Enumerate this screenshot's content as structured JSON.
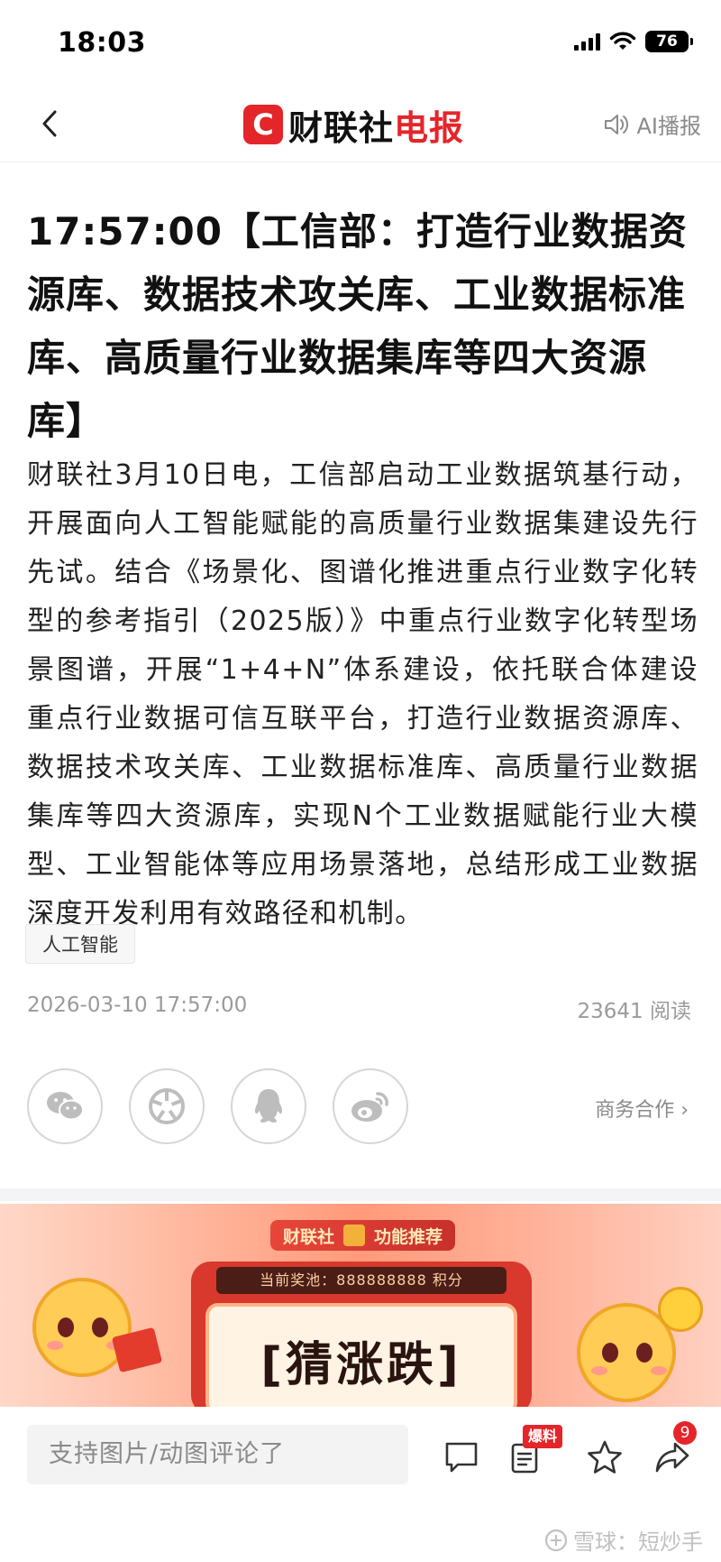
{
  "status_bar": {
    "time": "18:03",
    "battery": "76"
  },
  "header": {
    "logo_mark": "C",
    "logo_main": "财联社",
    "logo_accent": "电报",
    "ai_play_label": "AI播报"
  },
  "article": {
    "title": "17:57:00【工信部：打造行业数据资源库、数据技术攻关库、工业数据标准库、高质量行业数据集库等四大资源库】",
    "body": "财联社3月10日电，工信部启动工业数据筑基行动，开展面向人工智能赋能的高质量行业数据集建设先行先试。结合《场景化、图谱化推进重点行业数字化转型的参考指引（2025版）》中重点行业数字化转型场景图谱，开展“1+4+N”体系建设，依托联合体建设重点行业数据可信互联平台，打造行业数据资源库、数据技术攻关库、工业数据标准库、高质量行业数据集库等四大资源库，实现N个工业数据赋能行业大模型、工业智能体等应用场景落地，总结形成工业数据深度开发利用有效路径和机制。",
    "tag": "人工智能",
    "datetime": "2026-03-10 17:57:00",
    "reads": "23641 阅读"
  },
  "share": {
    "icons": [
      "wechat-icon",
      "moments-icon",
      "qq-icon",
      "weibo-icon"
    ],
    "business_link": "商务合作 ›"
  },
  "banner": {
    "pill_left": "财联社",
    "pill_right": "功能推荐",
    "prize_text": "当前奖池：888888888 积分",
    "game_title": "[猜涨跌]"
  },
  "bottom_bar": {
    "comment_placeholder": "支持图片/动图评论了",
    "baoliao_badge": "爆料",
    "share_count": "9",
    "watermark": "雪球：短炒手"
  },
  "colors": {
    "brand_red": "#e4252a"
  }
}
